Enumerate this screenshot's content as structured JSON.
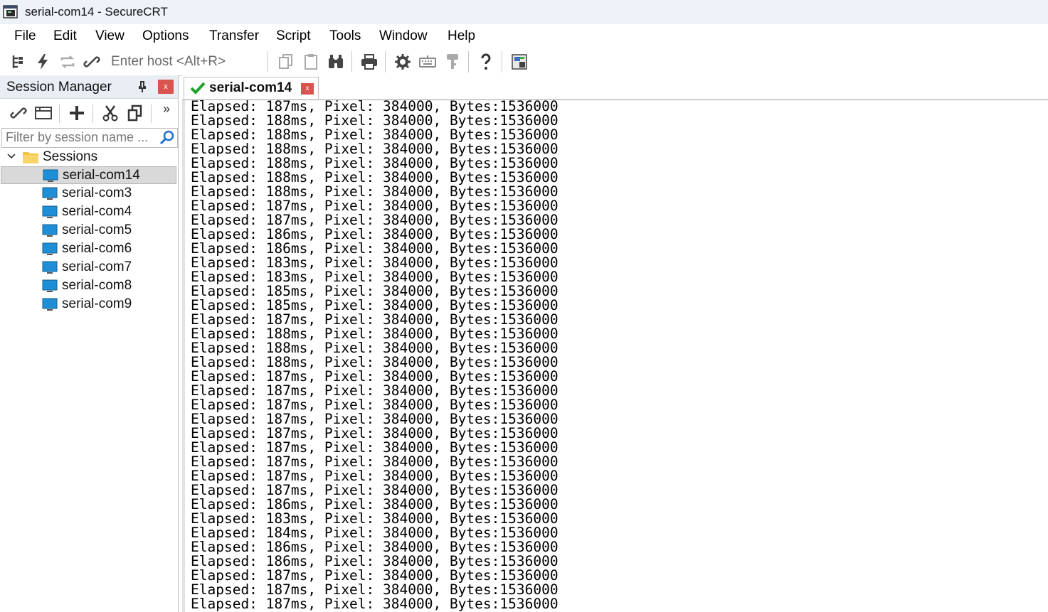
{
  "window": {
    "title": "serial-com14 - SecureCRT"
  },
  "menu": [
    "File",
    "Edit",
    "View",
    "Options",
    "Transfer",
    "Script",
    "Tools",
    "Window",
    "Help"
  ],
  "toolbar": {
    "host_placeholder": "Enter host <Alt+R>"
  },
  "session_manager": {
    "title": "Session Manager",
    "close_label": "x",
    "more_label": "»",
    "filter_placeholder": "Filter by session name ...",
    "root_folder": "Sessions",
    "sessions": [
      "serial-com14",
      "serial-com3",
      "serial-com4",
      "serial-com5",
      "serial-com6",
      "serial-com7",
      "serial-com8",
      "serial-com9"
    ],
    "selected": "serial-com14"
  },
  "tabs": [
    {
      "label": "serial-com14",
      "close_label": "x"
    }
  ],
  "terminal": {
    "lines": [
      "Elapsed: 187ms, Pixel: 384000, Bytes:1536000",
      "Elapsed: 188ms, Pixel: 384000, Bytes:1536000",
      "Elapsed: 188ms, Pixel: 384000, Bytes:1536000",
      "Elapsed: 188ms, Pixel: 384000, Bytes:1536000",
      "Elapsed: 188ms, Pixel: 384000, Bytes:1536000",
      "Elapsed: 188ms, Pixel: 384000, Bytes:1536000",
      "Elapsed: 188ms, Pixel: 384000, Bytes:1536000",
      "Elapsed: 187ms, Pixel: 384000, Bytes:1536000",
      "Elapsed: 187ms, Pixel: 384000, Bytes:1536000",
      "Elapsed: 186ms, Pixel: 384000, Bytes:1536000",
      "Elapsed: 186ms, Pixel: 384000, Bytes:1536000",
      "Elapsed: 183ms, Pixel: 384000, Bytes:1536000",
      "Elapsed: 183ms, Pixel: 384000, Bytes:1536000",
      "Elapsed: 185ms, Pixel: 384000, Bytes:1536000",
      "Elapsed: 185ms, Pixel: 384000, Bytes:1536000",
      "Elapsed: 187ms, Pixel: 384000, Bytes:1536000",
      "Elapsed: 188ms, Pixel: 384000, Bytes:1536000",
      "Elapsed: 188ms, Pixel: 384000, Bytes:1536000",
      "Elapsed: 188ms, Pixel: 384000, Bytes:1536000",
      "Elapsed: 187ms, Pixel: 384000, Bytes:1536000",
      "Elapsed: 187ms, Pixel: 384000, Bytes:1536000",
      "Elapsed: 187ms, Pixel: 384000, Bytes:1536000",
      "Elapsed: 187ms, Pixel: 384000, Bytes:1536000",
      "Elapsed: 187ms, Pixel: 384000, Bytes:1536000",
      "Elapsed: 187ms, Pixel: 384000, Bytes:1536000",
      "Elapsed: 187ms, Pixel: 384000, Bytes:1536000",
      "Elapsed: 187ms, Pixel: 384000, Bytes:1536000",
      "Elapsed: 187ms, Pixel: 384000, Bytes:1536000",
      "Elapsed: 186ms, Pixel: 384000, Bytes:1536000",
      "Elapsed: 183ms, Pixel: 384000, Bytes:1536000",
      "Elapsed: 184ms, Pixel: 384000, Bytes:1536000",
      "Elapsed: 186ms, Pixel: 384000, Bytes:1536000",
      "Elapsed: 186ms, Pixel: 384000, Bytes:1536000",
      "Elapsed: 187ms, Pixel: 384000, Bytes:1536000",
      "Elapsed: 187ms, Pixel: 384000, Bytes:1536000",
      "Elapsed: 187ms, Pixel: 384000, Bytes:1536000"
    ]
  },
  "colors": {
    "titlebar_bg": "#eef2f9",
    "panel_header_bg": "#e9edf4",
    "close_red": "#d9534f",
    "connected_green": "#1fa32a",
    "monitor_blue": "#1e8fd6",
    "folder_yellow": "#f4c542"
  }
}
